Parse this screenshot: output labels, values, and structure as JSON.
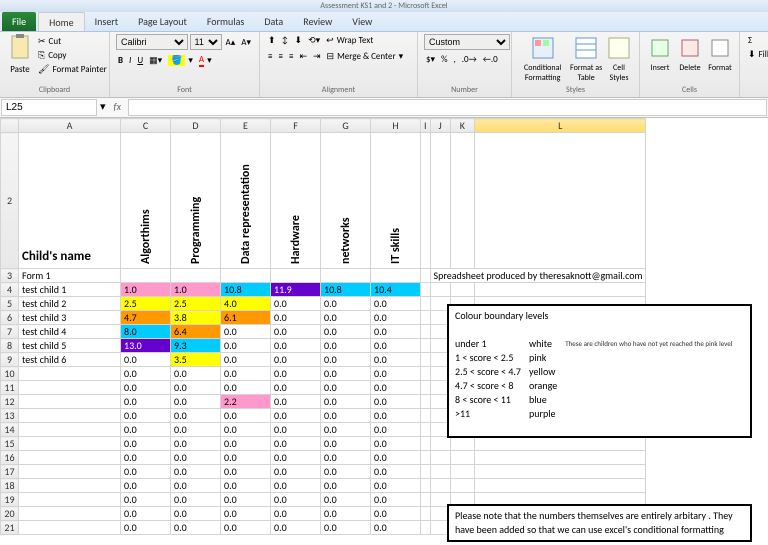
{
  "titlebar": "Assessment KS1 and 2 - Microsoft Excel",
  "tabs": {
    "file": "File",
    "items": [
      "Home",
      "Insert",
      "Page Layout",
      "Formulas",
      "Data",
      "Review",
      "View"
    ],
    "active": "Home"
  },
  "ribbon": {
    "clipboard": {
      "label": "Clipboard",
      "paste": "Paste",
      "cut": "Cut",
      "copy": "Copy",
      "format_painter": "Format Painter"
    },
    "font": {
      "label": "Font",
      "name": "Calibri",
      "size": "11"
    },
    "alignment": {
      "label": "Alignment",
      "wrap": "Wrap Text",
      "merge": "Merge & Center"
    },
    "number": {
      "label": "Number",
      "format": "Custom"
    },
    "styles": {
      "label": "Styles",
      "cond": "Conditional\nFormatting",
      "table": "Format\nas Table",
      "cell": "Cell\nStyles"
    },
    "cells": {
      "label": "Cells",
      "insert": "Insert",
      "delete": "Delete",
      "format": "Format"
    },
    "editing": {
      "fill": "Fill"
    }
  },
  "namebox": "L25",
  "columns": [
    "A",
    "C",
    "D",
    "E",
    "F",
    "G",
    "H",
    "I",
    "J",
    "K",
    "L"
  ],
  "headers": {
    "name": "Child's name",
    "c": "Algorthims",
    "d": "Programming",
    "e": "Data representation",
    "f": "Hardware",
    "g": "networks",
    "h": "IT skills"
  },
  "form_label": "Form 1",
  "credit": "Spreadsheet produced by theresaknott@gmail.com",
  "rows": [
    {
      "name": "test child 1",
      "vals": [
        "1.0",
        "1.0",
        "10.8",
        "11.9",
        "10.8",
        "10.4"
      ],
      "colors": [
        "pink",
        "pink",
        "blue",
        "purple",
        "blue",
        "blue"
      ]
    },
    {
      "name": "test child 2",
      "vals": [
        "2.5",
        "2.5",
        "4.0",
        "0.0",
        "0.0",
        "0.0"
      ],
      "colors": [
        "yellow",
        "yellow",
        "yellow",
        "",
        "",
        ""
      ]
    },
    {
      "name": "test child 3",
      "vals": [
        "4.7",
        "3.8",
        "6.1",
        "0.0",
        "0.0",
        "0.0"
      ],
      "colors": [
        "orange",
        "yellow",
        "orange",
        "",
        "",
        ""
      ]
    },
    {
      "name": "test child 4",
      "vals": [
        "8.0",
        "6.4",
        "0.0",
        "0.0",
        "0.0",
        "0.0"
      ],
      "colors": [
        "blue",
        "orange",
        "",
        "",
        "",
        ""
      ]
    },
    {
      "name": "test child 5",
      "vals": [
        "13.0",
        "9.3",
        "0.0",
        "0.0",
        "0.0",
        "0.0"
      ],
      "colors": [
        "purple",
        "blue",
        "",
        "",
        "",
        ""
      ]
    },
    {
      "name": "test child 6",
      "vals": [
        "0.0",
        "3.5",
        "0.0",
        "0.0",
        "0.0",
        "0.0"
      ],
      "colors": [
        "",
        "yellow",
        "",
        "",
        "",
        ""
      ]
    },
    {
      "name": "",
      "vals": [
        "0.0",
        "0.0",
        "0.0",
        "0.0",
        "0.0",
        "0.0"
      ],
      "colors": [
        "",
        "",
        "",
        "",
        "",
        ""
      ]
    },
    {
      "name": "",
      "vals": [
        "0.0",
        "0.0",
        "0.0",
        "0.0",
        "0.0",
        "0.0"
      ],
      "colors": [
        "",
        "",
        "",
        "",
        "",
        ""
      ]
    },
    {
      "name": "",
      "vals": [
        "0.0",
        "0.0",
        "2.2",
        "0.0",
        "0.0",
        "0.0"
      ],
      "colors": [
        "",
        "",
        "pink",
        "",
        "",
        ""
      ]
    },
    {
      "name": "",
      "vals": [
        "0.0",
        "0.0",
        "0.0",
        "0.0",
        "0.0",
        "0.0"
      ],
      "colors": [
        "",
        "",
        "",
        "",
        "",
        ""
      ]
    },
    {
      "name": "",
      "vals": [
        "0.0",
        "0.0",
        "0.0",
        "0.0",
        "0.0",
        "0.0"
      ],
      "colors": [
        "",
        "",
        "",
        "",
        "",
        ""
      ]
    },
    {
      "name": "",
      "vals": [
        "0.0",
        "0.0",
        "0.0",
        "0.0",
        "0.0",
        "0.0"
      ],
      "colors": [
        "",
        "",
        "",
        "",
        "",
        ""
      ]
    },
    {
      "name": "",
      "vals": [
        "0.0",
        "0.0",
        "0.0",
        "0.0",
        "0.0",
        "0.0"
      ],
      "colors": [
        "",
        "",
        "",
        "",
        "",
        ""
      ]
    },
    {
      "name": "",
      "vals": [
        "0.0",
        "0.0",
        "0.0",
        "0.0",
        "0.0",
        "0.0"
      ],
      "colors": [
        "",
        "",
        "",
        "",
        "",
        ""
      ]
    },
    {
      "name": "",
      "vals": [
        "0.0",
        "0.0",
        "0.0",
        "0.0",
        "0.0",
        "0.0"
      ],
      "colors": [
        "",
        "",
        "",
        "",
        "",
        ""
      ]
    },
    {
      "name": "",
      "vals": [
        "0.0",
        "0.0",
        "0.0",
        "0.0",
        "0.0",
        "0.0"
      ],
      "colors": [
        "",
        "",
        "",
        "",
        "",
        ""
      ]
    },
    {
      "name": "",
      "vals": [
        "0.0",
        "0.0",
        "0.0",
        "0.0",
        "0.0",
        "0.0"
      ],
      "colors": [
        "",
        "",
        "",
        "",
        "",
        ""
      ]
    },
    {
      "name": "",
      "vals": [
        "0.0",
        "0.0",
        "0.0",
        "0.0",
        "0.0",
        "0.0"
      ],
      "colors": [
        "",
        "",
        "",
        "",
        "",
        ""
      ]
    }
  ],
  "legend": {
    "title": "Colour boundary levels",
    "rows": [
      {
        "range": "under 1",
        "name": "white"
      },
      {
        "range": "1 < score < 2.5",
        "name": "pink"
      },
      {
        "range": "2.5 < score < 4.7",
        "name": "yellow"
      },
      {
        "range": "4.7 < score < 8",
        "name": "orange"
      },
      {
        "range": "8 < score < 11",
        "name": "blue"
      },
      {
        "range": ">11",
        "name": "purple"
      }
    ],
    "side_note": "These are children who have not yet reached the pink level"
  },
  "note": "Please note that the numbers themselves are entirely arbitary . They have been added so that we can use excel's conditional formatting"
}
